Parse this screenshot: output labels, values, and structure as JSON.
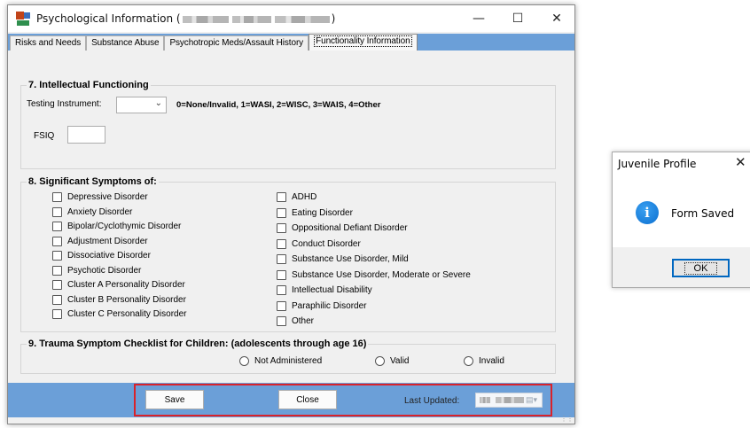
{
  "window": {
    "title_prefix": "Psychological Information (",
    "title_suffix": ")",
    "minimize": "—",
    "maximize": "☐",
    "close": "✕"
  },
  "tabs": [
    {
      "label": "Risks and Needs"
    },
    {
      "label": "Substance Abuse"
    },
    {
      "label": "Psychotropic Meds/Assault History"
    },
    {
      "label": "Functionality Information",
      "active": true
    }
  ],
  "intellectual": {
    "title": "7. Intellectual Functioning",
    "testing_label": "Testing Instrument:",
    "testing_value": "",
    "legend": "0=None/Invalid, 1=WASI, 2=WISC, 3=WAIS, 4=Other",
    "fsiq_label": "FSIQ",
    "fsiq_value": ""
  },
  "symptoms": {
    "title": "8. Significant Symptoms of:",
    "left": [
      "Depressive Disorder",
      "Anxiety Disorder",
      "Bipolar/Cyclothymic Disorder",
      "Adjustment Disorder",
      "Dissociative Disorder",
      "Psychotic Disorder",
      "Cluster A Personality Disorder",
      "Cluster B Personality Disorder",
      "Cluster C Personality Disorder"
    ],
    "right": [
      "ADHD",
      "Eating Disorder",
      "Oppositional Defiant Disorder",
      "Conduct Disorder",
      "Substance Use Disorder, Mild",
      "Substance Use Disorder, Moderate or Severe",
      "Intellectual Disability",
      "Paraphilic Disorder",
      "Other"
    ]
  },
  "trauma": {
    "title": "9. Trauma Symptom Checklist for Children: (adolescents through age 16)",
    "options": [
      "Not Administered",
      "Valid",
      "Invalid"
    ]
  },
  "footer": {
    "save_label": "Save",
    "close_label": "Close",
    "last_updated_label": "Last Updated:"
  },
  "dialog": {
    "title": "Juvenile Profile",
    "close": "✕",
    "message": "Form Saved",
    "ok_label": "OK",
    "icon": "info-icon"
  },
  "colors": {
    "accent_blue": "#6b9fd8",
    "highlight_red": "#d9222a",
    "dialog_focus": "#0067c0"
  }
}
